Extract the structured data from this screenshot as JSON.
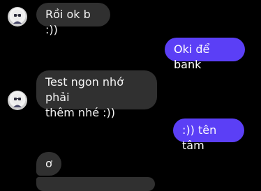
{
  "conversation": {
    "messages": [
      {
        "sender": "other",
        "text": "Rồi ok b :))"
      },
      {
        "sender": "me",
        "text": "Oki để bank"
      },
      {
        "sender": "other",
        "text_lines": [
          "Test ngon nhớ phải",
          "thêm nhé :))"
        ]
      },
      {
        "sender": "me",
        "text": ":)) tên tâm"
      },
      {
        "sender": "other",
        "text": "ơ"
      }
    ]
  },
  "colors": {
    "background": "#000000",
    "incoming_bubble": "#303030",
    "outgoing_bubble": "#5b3ff6"
  }
}
